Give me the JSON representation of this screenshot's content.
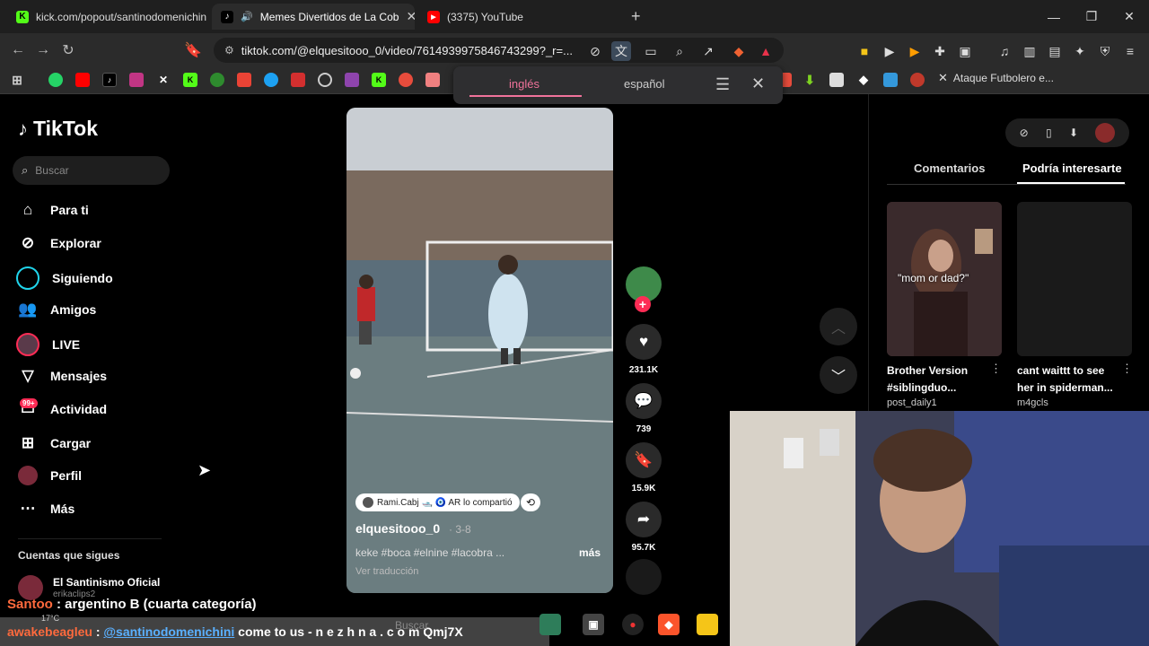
{
  "browser": {
    "tabs": [
      {
        "label": "kick.com/popout/santinodomenichin",
        "favicon": "kick-icon"
      },
      {
        "label": "Memes Divertidos de La Cob",
        "favicon": "tiktok-icon",
        "audio": true
      },
      {
        "label": "(3375) YouTube",
        "favicon": "youtube-icon"
      }
    ],
    "new_tab": "+",
    "url": "tiktok.com/@elquesitooo_0/video/7614939975846743299?_r=..."
  },
  "bookmarks": {
    "last_label": "Ataque Futbolero e..."
  },
  "translate": {
    "lang_from": "inglés",
    "lang_to": "español"
  },
  "tiktok": {
    "logo": "TikTok",
    "search_placeholder": "Buscar",
    "nav": [
      {
        "label": "Para ti",
        "icon": "home-icon"
      },
      {
        "label": "Explorar",
        "icon": "compass-icon"
      },
      {
        "label": "Siguiendo",
        "icon": "following-icon"
      },
      {
        "label": "Amigos",
        "icon": "friends-icon"
      },
      {
        "label": "LIVE",
        "icon": "live-icon"
      },
      {
        "label": "Mensajes",
        "icon": "send-icon"
      },
      {
        "label": "Actividad",
        "icon": "inbox-icon"
      },
      {
        "label": "Cargar",
        "icon": "upload-icon"
      },
      {
        "label": "Perfil",
        "icon": "profile-icon"
      },
      {
        "label": "Más",
        "icon": "more-icon"
      }
    ],
    "activity_badge": "99+",
    "following_title": "Cuentas que sigues",
    "following_account": {
      "name": "El Santinismo Oficial",
      "handle": "erikaclips2"
    },
    "video": {
      "shared_by": "Rami.Cabj 🛥️ 🧿 AR lo compartió",
      "author": "elquesitooo_0",
      "date": "· 3-8",
      "caption": "keke #boca #elnine #lacobra ...",
      "more": "más",
      "translate": "Ver traducción"
    },
    "actions": {
      "likes": "231.1K",
      "comments": "739",
      "saves": "15.9K",
      "shares": "95.7K"
    },
    "right_panel": {
      "tab_comments": "Comentarios",
      "tab_interest": "Podría interesarte",
      "cards": [
        {
          "overlay": "\"mom or dad?\"",
          "title": "Brother Version #siblingduo...",
          "user": "post_daily1"
        },
        {
          "overlay": "",
          "title": "cant waittt to see her in spiderman...",
          "user": "m4gcls"
        }
      ]
    }
  },
  "stream_chat": [
    {
      "user": "Santoo",
      "message": ": argentino B (cuarta categoría)"
    },
    {
      "user": "awakebeagleu",
      "mention": "@santinodomenichini",
      "message": "come to us - n e z h n a . c o m Qmj7X"
    }
  ],
  "taskbar": {
    "search_placeholder": "Buscar",
    "temperature": "17°C"
  },
  "colors": {
    "tiktok_red": "#fe2c55",
    "translate_accent": "#f0729a",
    "chat_user": "#ff6a3d",
    "chat_mention": "#5ab0ff"
  }
}
